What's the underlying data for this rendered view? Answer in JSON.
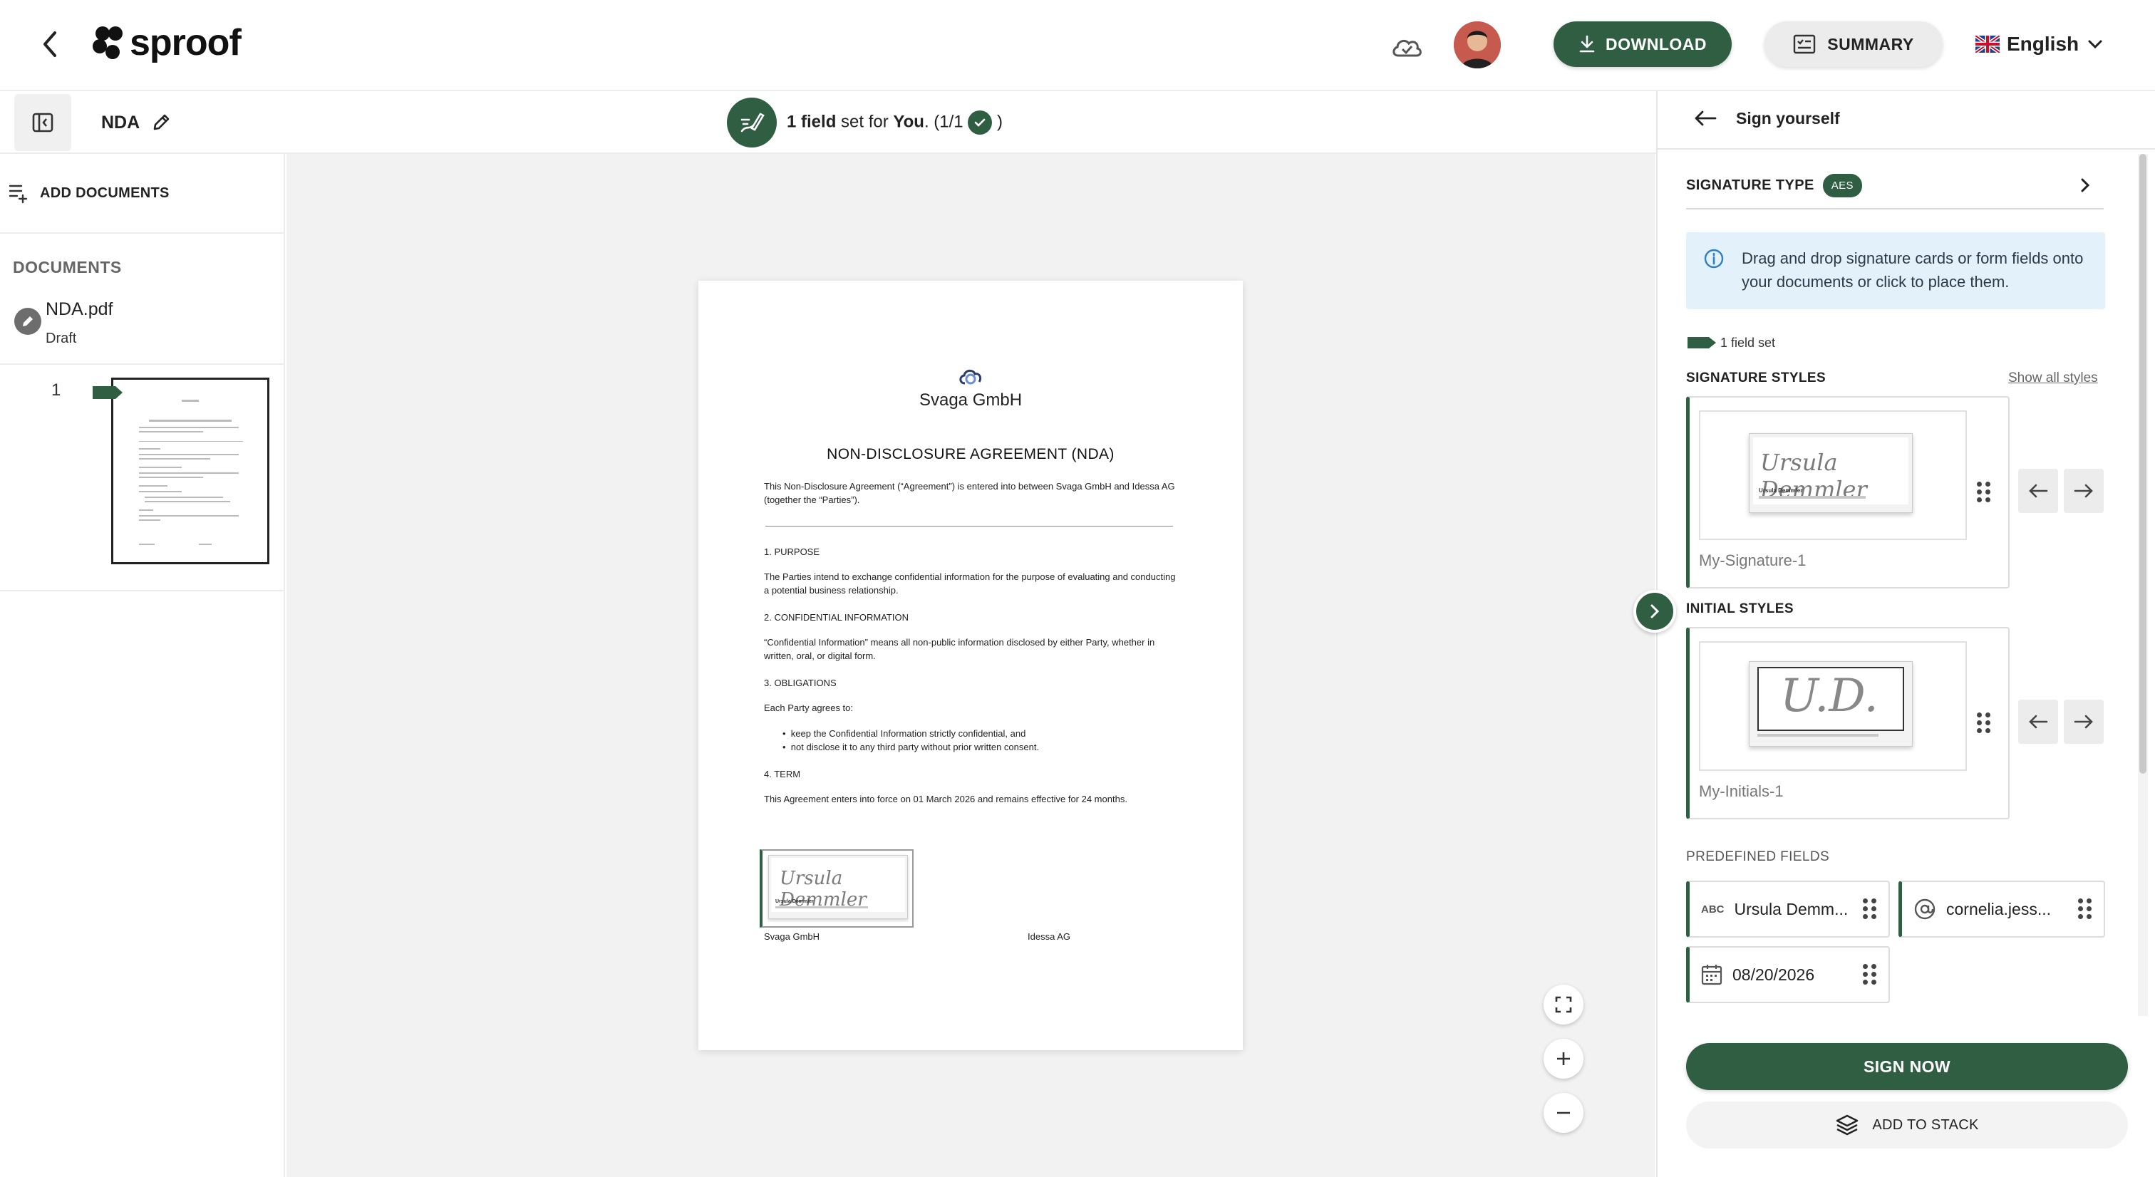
{
  "header": {
    "logo_text": "sproof",
    "download_label": "DOWNLOAD",
    "summary_label": "SUMMARY",
    "language": "English"
  },
  "subbar": {
    "document_title": "NDA",
    "status": {
      "count": "1 field",
      "mid": " set for ",
      "who": "You",
      "progress_prefix": ". (1/1",
      "progress_suffix": " )"
    }
  },
  "left_panel": {
    "add_documents": "ADD DOCUMENTS",
    "documents_heading": "DOCUMENTS",
    "documents": [
      {
        "filename": "NDA.pdf",
        "status": "Draft"
      }
    ],
    "pages": [
      "1"
    ]
  },
  "document": {
    "company": "Svaga GmbH",
    "title": "NON-DISCLOSURE AGREEMENT (NDA)",
    "intro": "This Non-Disclosure Agreement (“Agreement”) is entered into between Svaga GmbH and Idessa AG (together the “Parties”).",
    "s1_head": "1. PURPOSE",
    "s1_text": "The Parties intend to exchange confidential information for the purpose of evaluating and conducting a potential business relationship.",
    "s2_head": "2. CONFIDENTIAL INFORMATION",
    "s2_text": "“Confidential Information” means all non-public information disclosed by either Party, whether in written, oral, or digital form.",
    "s3_head": "3. OBLIGATIONS",
    "s3_text": "Each Party agrees to:",
    "s3_bullets": [
      "keep the Confidential Information strictly confidential, and",
      "not disclose it to any third party without prior written consent."
    ],
    "s4_head": "4. TERM",
    "s4_text": "This Agreement enters into force on 01 March 2026 and remains effective for 24 months.",
    "sig_script": "Ursula Demmler",
    "sig_name": "Ursula Demmler",
    "party_left": "Svaga GmbH",
    "party_right": "Idessa AG"
  },
  "right_panel": {
    "back_title": "Sign yourself",
    "signature_type_label": "SIGNATURE TYPE",
    "signature_type_badge": "AES",
    "info_text": "Drag and drop signature cards or form fields onto your documents or click to place them.",
    "field_count": "1 field set",
    "signature_styles_label": "SIGNATURE STYLES",
    "show_all_styles": "Show all styles",
    "signature_style": {
      "script": "Ursula Demmler",
      "name": "Ursula Demmler",
      "caption": "My-Signature-1"
    },
    "initial_styles_label": "INITIAL STYLES",
    "initial_style": {
      "script": "U.D.",
      "caption": "My-Initials-1"
    },
    "predefined_fields_label": "PREDEFINED FIELDS",
    "predefined_fields": [
      {
        "icon": "text-field-icon",
        "icon_text": "ABC",
        "value": "Ursula Demm..."
      },
      {
        "icon": "at-icon",
        "value": "cornelia.jess..."
      },
      {
        "icon": "calendar-icon",
        "value": "08/20/2026"
      }
    ],
    "sign_now": "SIGN NOW",
    "add_to_stack": "ADD TO STACK"
  },
  "colors": {
    "accent": "#2f5e43",
    "info_bg": "#e3f1fa",
    "canvas_bg": "#f2f2f2"
  }
}
